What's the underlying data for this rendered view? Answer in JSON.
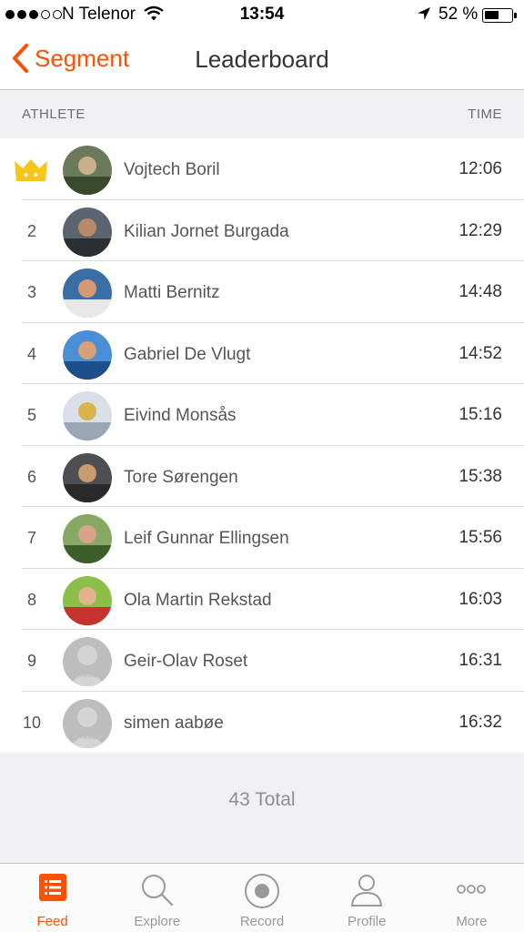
{
  "status_bar": {
    "carrier": "N Telenor",
    "time": "13:54",
    "battery_percent": "52 %",
    "battery_level": 0.52
  },
  "nav": {
    "back_label": "Segment",
    "title": "Leaderboard"
  },
  "columns": {
    "athlete": "ATHLETE",
    "time": "TIME"
  },
  "rows": [
    {
      "rank": "1",
      "name": "Vojtech Boril",
      "time": "12:06",
      "crown": true,
      "avatar": "photo"
    },
    {
      "rank": "2",
      "name": "Kilian Jornet Burgada",
      "time": "12:29",
      "avatar": "photo"
    },
    {
      "rank": "3",
      "name": "Matti Bernitz",
      "time": "14:48",
      "avatar": "photo"
    },
    {
      "rank": "4",
      "name": "Gabriel De Vlugt",
      "time": "14:52",
      "avatar": "photo"
    },
    {
      "rank": "5",
      "name": "Eivind Monsås",
      "time": "15:16",
      "avatar": "photo"
    },
    {
      "rank": "6",
      "name": "Tore Sørengen",
      "time": "15:38",
      "avatar": "photo"
    },
    {
      "rank": "7",
      "name": "Leif Gunnar Ellingsen",
      "time": "15:56",
      "avatar": "photo"
    },
    {
      "rank": "8",
      "name": "Ola Martin Rekstad",
      "time": "16:03",
      "avatar": "photo"
    },
    {
      "rank": "9",
      "name": "Geir-Olav Roset",
      "time": "16:31",
      "avatar": "default"
    },
    {
      "rank": "10",
      "name": "simen aabøe",
      "time": "16:32",
      "avatar": "default"
    }
  ],
  "total": "43 Total",
  "tabs": [
    {
      "label": "Feed",
      "icon": "feed-icon",
      "active": true
    },
    {
      "label": "Explore",
      "icon": "search-icon",
      "active": false
    },
    {
      "label": "Record",
      "icon": "record-icon",
      "active": false
    },
    {
      "label": "Profile",
      "icon": "profile-icon",
      "active": false
    },
    {
      "label": "More",
      "icon": "more-icon",
      "active": false
    }
  ],
  "colors": {
    "accent": "#fc5200",
    "crown": "#f5c518",
    "header_bg": "#f0f0f2"
  }
}
